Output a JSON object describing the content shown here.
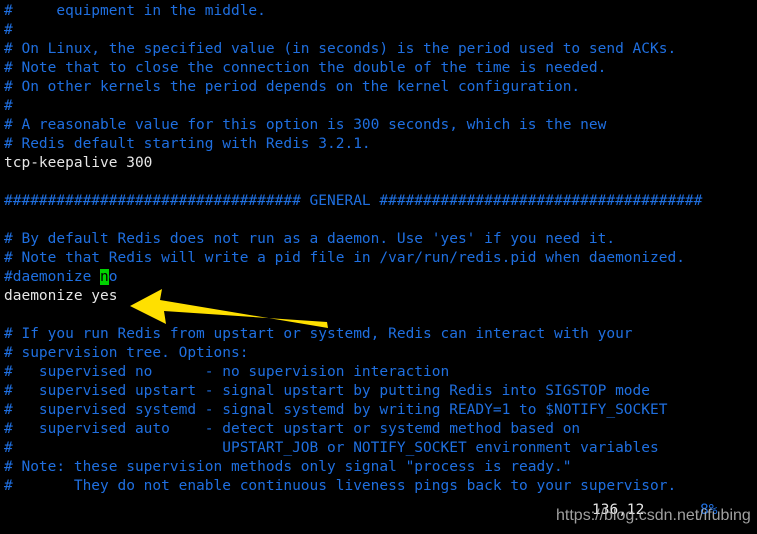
{
  "terminal": {
    "background_color": "#000000",
    "comment_color": "#1f6fe0",
    "config_color": "#e6e6e6",
    "cursor_color": "#00d200",
    "lines": [
      "#     equipment in the middle.",
      "#",
      "# On Linux, the specified value (in seconds) is the period used to send ACKs.",
      "# Note that to close the connection the double of the time is needed.",
      "# On other kernels the period depends on the kernel configuration.",
      "#",
      "# A reasonable value for this option is 300 seconds, which is the new",
      "# Redis default starting with Redis 3.2.1.",
      "tcp-keepalive 300",
      "",
      "################################## GENERAL #####################################",
      "",
      "# By default Redis does not run as a daemon. Use 'yes' if you need it.",
      "# Note that Redis will write a pid file in /var/run/redis.pid when daemonized.",
      "#daemonize no",
      "daemonize yes",
      "",
      "# If you run Redis from upstart or systemd, Redis can interact with your",
      "# supervision tree. Options:",
      "#   supervised no      - no supervision interaction",
      "#   supervised upstart - signal upstart by putting Redis into SIGSTOP mode",
      "#   supervised systemd - signal systemd by writing READY=1 to $NOTIFY_SOCKET",
      "#   supervised auto    - detect upstart or systemd method based on",
      "#                        UPSTART_JOB or NOTIFY_SOCKET environment variables",
      "# Note: these supervision methods only signal \"process is ready.\"",
      "#       They do not enable continuous liveness pings back to your supervisor."
    ],
    "cursor_line": {
      "prefix": "#daemonize ",
      "cursor_char": "n",
      "suffix": "o"
    },
    "config_lines": [
      "tcp-keepalive 300",
      "daemonize yes"
    ]
  },
  "statusbar": {
    "position": "136,12",
    "percent": "8%"
  },
  "annotation": {
    "arrow_color": "#ffe000",
    "arrow_name": "left-pointing-arrow"
  },
  "watermark": {
    "text": "https://blog.csdn.net/ifubing"
  }
}
